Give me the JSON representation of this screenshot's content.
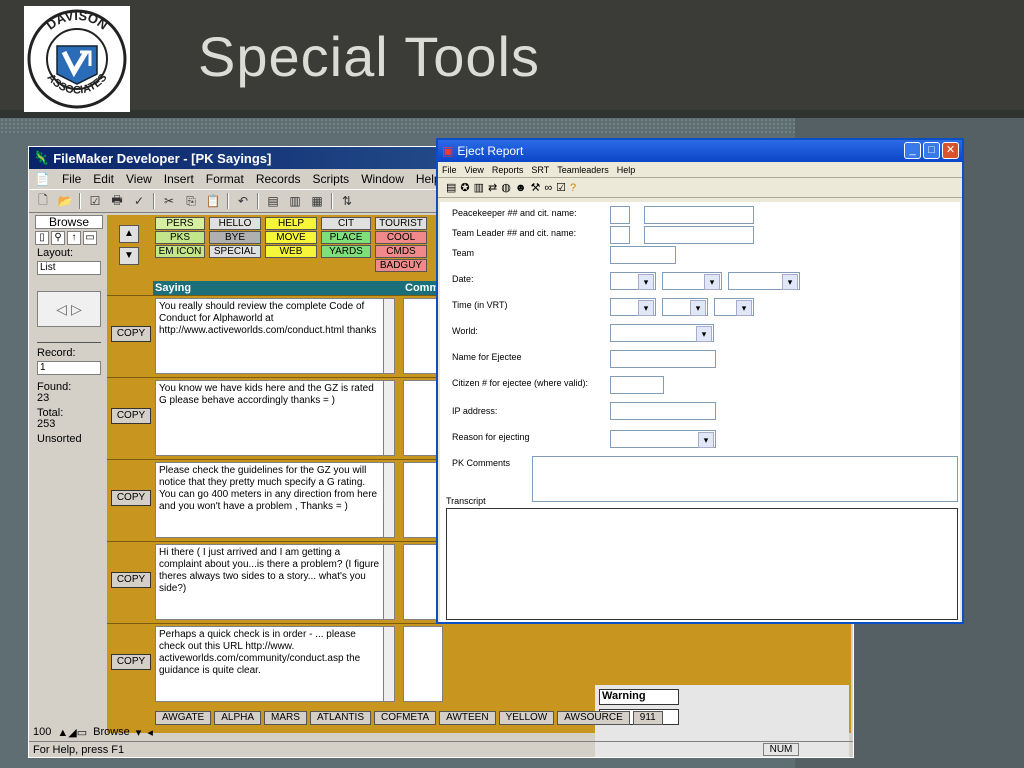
{
  "slide": {
    "title": "Special Tools",
    "logo_text_top": "DAVISON",
    "logo_text_bottom": "ASSOCIATES"
  },
  "filemaker": {
    "title": "FileMaker Developer - [PK Sayings]",
    "menu": [
      "File",
      "Edit",
      "View",
      "Insert",
      "Format",
      "Records",
      "Scripts",
      "Window",
      "Help"
    ],
    "mode": "Browse",
    "layout_label": "Layout:",
    "layout_value": "List",
    "record_label": "Record:",
    "record_value": "1",
    "found_label": "Found:",
    "found_value": "23",
    "total_label": "Total:",
    "total_value": "253",
    "sort_status": "Unsorted",
    "header_saying": "Saying",
    "header_comments": "Comm",
    "tags": [
      [
        "PERS",
        "HELLO",
        "HELP",
        "CIT",
        "TOURIST"
      ],
      [
        "PKS",
        "BYE",
        "MOVE",
        "PLACE",
        "COOL"
      ],
      [
        "EM ICON",
        "SPECIAL",
        "WEB",
        "YARDS",
        "CMDS"
      ],
      [
        "",
        "",
        "",
        "",
        "BADGUY"
      ]
    ],
    "copy_label": "COPY",
    "records": [
      "You really should review the complete Code of Conduct for Alphaworld at http://www.activeworlds.com/conduct.html thanks",
      "You know we have kids here and the GZ is rated G please behave accordingly thanks = )",
      "Please check the guidelines for the GZ you will notice that they pretty much specify a G rating.  You can go 400 meters in any direction from here and you won't have a problem , Thanks  = )",
      "Hi there ( I just arrived and I am getting a complaint about you...is there a problem? (I figure theres always two sides to a story... what's you side?)",
      "Perhaps a quick check is in order - ... please check out this URL http://www. activeworlds.com/community/conduct.asp the guidance is quite clear."
    ],
    "bottom_tags": [
      "AWGATE",
      "ALPHA",
      "MARS",
      "ATLANTIS",
      "COFMETA",
      "AWTEEN",
      "YELLOW",
      "AWSOURCE",
      "911"
    ],
    "warning_label": "Warning",
    "zoom": "100",
    "mode_bottom": "Browse",
    "status_text": "For Help, press F1",
    "num_indicator": "NUM"
  },
  "eject": {
    "title": "Eject Report",
    "menu": [
      "File",
      "View",
      "Reports",
      "SRT",
      "Teamleaders",
      "Help"
    ],
    "fields": {
      "peacekeeper": "Peacekeeper ## and cit. name:",
      "teamleader": "Team Leader ## and cit. name:",
      "team": "Team",
      "date": "Date:",
      "time": "Time (in VRT)",
      "world": "World:",
      "ejectee_name": "Name for Ejectee",
      "citizen": "Citizen # for ejectee (where valid):",
      "ip": "IP address:",
      "reason": "Reason for ejecting",
      "pk_comments": "PK Comments",
      "transcript": "Transcript"
    }
  },
  "colors": {
    "slide_header": "#3b3b38",
    "slide_bg": "#5f6e72",
    "fm_body": "#c8951e",
    "teal_header": "#1a6f7a",
    "xp_blue": "#0a46c8"
  }
}
